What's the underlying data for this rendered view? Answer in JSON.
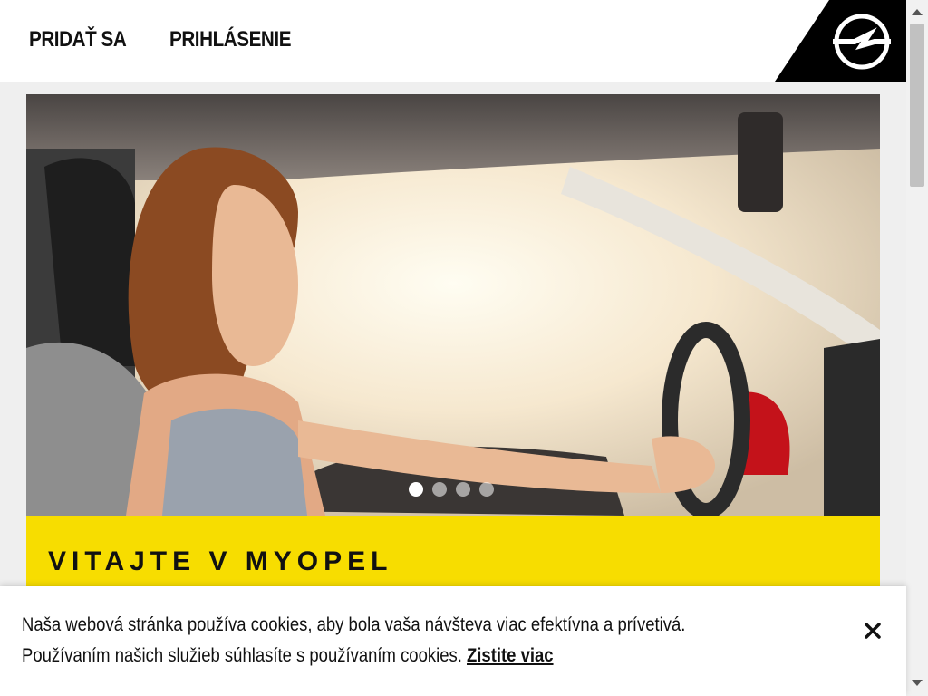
{
  "header": {
    "join_label": "PRIDAŤ SA",
    "login_label": "PRIHLÁSENIE",
    "logo_icon": "opel-logo-icon"
  },
  "hero": {
    "slide_count": 4,
    "active_slide": 1
  },
  "welcome": {
    "title": "VITAJTE V MYOPEL"
  },
  "cookie": {
    "line1": "Naša webová stránka používa cookies, aby bola vaša návšteva viac efektívna a prívetivá.",
    "line2": "Používaním našich služieb súhlasíte s používaním cookies.",
    "link_label": "Zistite viac",
    "close_icon": "close-icon"
  },
  "colors": {
    "brand_yellow": "#f7dd00",
    "logo_black": "#000000"
  }
}
